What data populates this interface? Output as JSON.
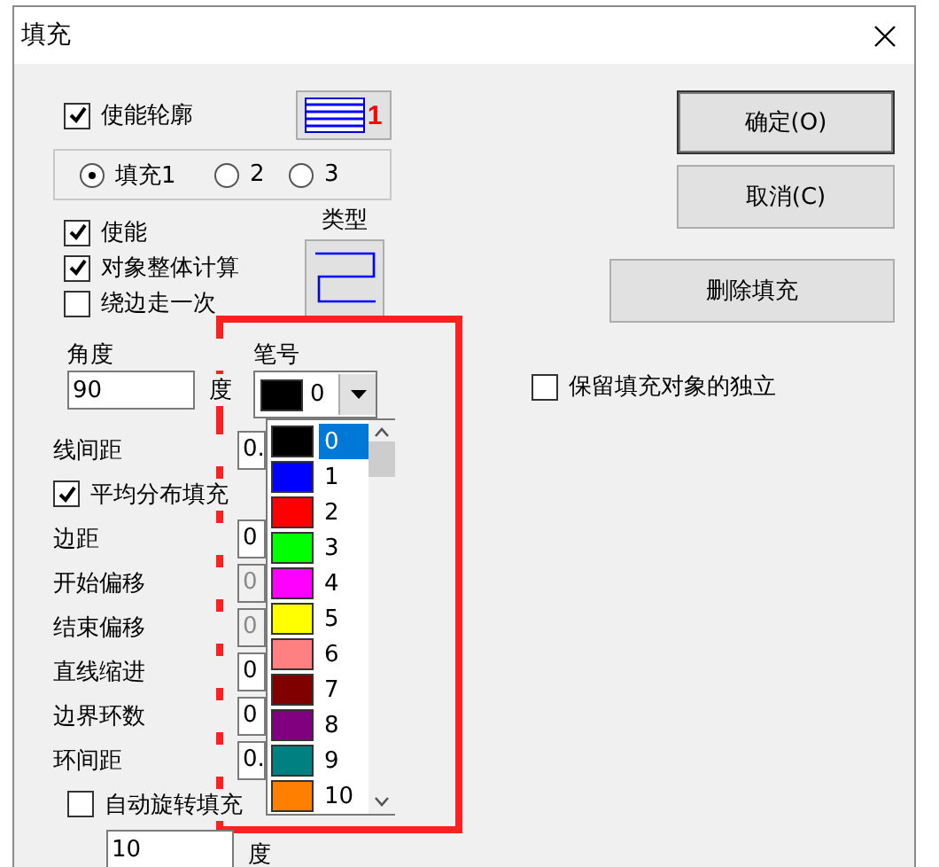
{
  "window": {
    "title": "填充"
  },
  "contour": {
    "label": "使能轮廓",
    "checked": true,
    "pen_badge": "1"
  },
  "fill_radios": [
    {
      "label": "填充1",
      "selected": true
    },
    {
      "label": "2",
      "selected": false
    },
    {
      "label": "3",
      "selected": false
    }
  ],
  "options": [
    {
      "label": "使能",
      "checked": true
    },
    {
      "label": "对象整体计算",
      "checked": true
    },
    {
      "label": "绕边走一次",
      "checked": false
    }
  ],
  "type_label": "类型",
  "angle": {
    "label": "角度",
    "value": "90",
    "unit": "度"
  },
  "pen": {
    "label": "笔号",
    "value": "0",
    "color": "#000000",
    "options": [
      {
        "label": "0",
        "color": "#000000",
        "selected": true
      },
      {
        "label": "1",
        "color": "#0000ff",
        "selected": false
      },
      {
        "label": "2",
        "color": "#ff0000",
        "selected": false
      },
      {
        "label": "3",
        "color": "#00ff00",
        "selected": false
      },
      {
        "label": "4",
        "color": "#ff00ff",
        "selected": false
      },
      {
        "label": "5",
        "color": "#ffff00",
        "selected": false
      },
      {
        "label": "6",
        "color": "#ff8080",
        "selected": false
      },
      {
        "label": "7",
        "color": "#800000",
        "selected": false
      },
      {
        "label": "8",
        "color": "#800080",
        "selected": false
      },
      {
        "label": "9",
        "color": "#008080",
        "selected": false
      },
      {
        "label": "10",
        "color": "#ff8000",
        "selected": false
      }
    ]
  },
  "params": [
    {
      "kind": "field",
      "label": "线间距",
      "value": "0.",
      "disabled": false
    },
    {
      "kind": "checkbox",
      "label": "平均分布填充",
      "checked": true
    },
    {
      "kind": "field",
      "label": "边距",
      "value": "0",
      "disabled": false
    },
    {
      "kind": "field",
      "label": "开始偏移",
      "value": "0",
      "disabled": true
    },
    {
      "kind": "field",
      "label": "结束偏移",
      "value": "0",
      "disabled": true
    },
    {
      "kind": "field",
      "label": "直线缩进",
      "value": "0",
      "disabled": false
    },
    {
      "kind": "field",
      "label": "边界环数",
      "value": "0",
      "disabled": false
    },
    {
      "kind": "field",
      "label": "环间距",
      "value": "0.",
      "disabled": false
    },
    {
      "kind": "checkbox",
      "label": "自动旋转填充",
      "checked": false
    }
  ],
  "rotate": {
    "value": "10",
    "unit": "度"
  },
  "buttons": [
    {
      "label": "确定(O)",
      "default": true
    },
    {
      "label": "取消(C)",
      "default": false
    }
  ],
  "delete_button": "删除填充",
  "keep_independent": {
    "label": "保留填充对象的独立",
    "checked": false
  }
}
